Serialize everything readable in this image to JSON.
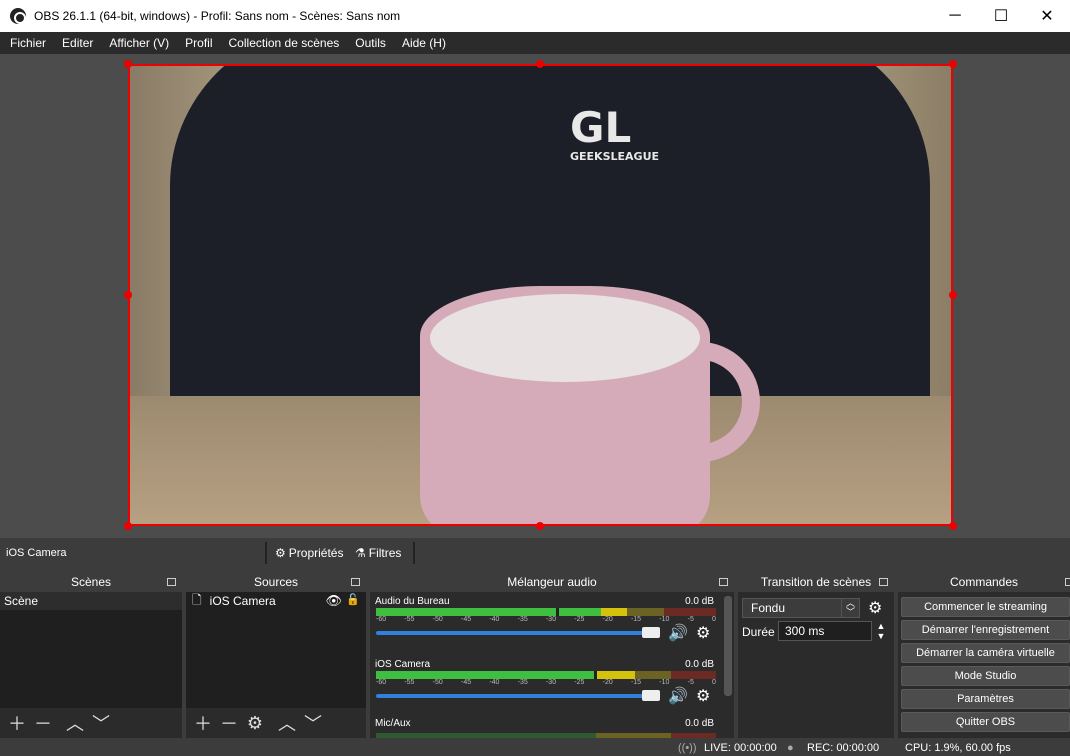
{
  "window": {
    "title": "OBS 26.1.1 (64-bit, windows) - Profil: Sans nom - Scènes: Sans nom",
    "minimize": "─",
    "maximize": "☐",
    "close": "✕"
  },
  "menu": {
    "items": [
      "Fichier",
      "Editer",
      "Afficher (V)",
      "Profil",
      "Collection de scènes",
      "Outils",
      "Aide (H)"
    ]
  },
  "preview": {
    "hoodie_logo": "GL",
    "hoodie_text": "GEEKSLEAGUE",
    "selection_color": "#e00000"
  },
  "context_bar": {
    "source_name": "iOS Camera",
    "properties_label": "Propriétés",
    "filters_label": "Filtres"
  },
  "scenes": {
    "title": "Scènes",
    "items": [
      "Scène"
    ]
  },
  "sources": {
    "title": "Sources",
    "items": [
      {
        "name": "iOS Camera",
        "visible": true,
        "locked": false
      }
    ]
  },
  "mixer": {
    "title": "Mélangeur audio",
    "ticks": [
      "-60",
      "-55",
      "-50",
      "-45",
      "-40",
      "-35",
      "-30",
      "-25",
      "-20",
      "-15",
      "-10",
      "-5",
      "0"
    ],
    "channels": [
      {
        "name": "Audio du Bureau",
        "db": "0.0 dB",
        "volume": 1.0
      },
      {
        "name": "iOS Camera",
        "db": "0.0 dB",
        "volume": 1.0
      },
      {
        "name": "Mic/Aux",
        "db": "0.0 dB",
        "volume": 1.0
      }
    ]
  },
  "transitions": {
    "title": "Transition de scènes",
    "selected": "Fondu",
    "duration_label": "Durée",
    "duration_value": "300 ms"
  },
  "controls": {
    "title": "Commandes",
    "buttons": [
      "Commencer le streaming",
      "Démarrer l'enregistrement",
      "Démarrer la caméra virtuelle",
      "Mode Studio",
      "Paramètres",
      "Quitter OBS"
    ]
  },
  "status": {
    "live": "LIVE: 00:00:00",
    "rec": "REC: 00:00:00",
    "cpu": "CPU: 1.9%, 60.00 fps"
  },
  "colors": {
    "meter_green": "#3fbf3f",
    "meter_yellow": "#d4c20d",
    "meter_red": "#c0392b",
    "slider_blue": "#3080e0"
  }
}
